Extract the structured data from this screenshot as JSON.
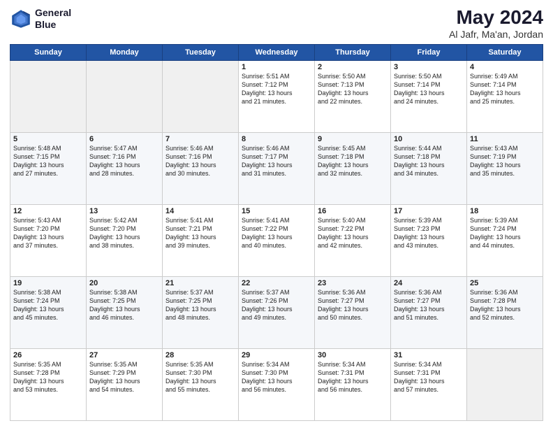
{
  "header": {
    "logo_line1": "General",
    "logo_line2": "Blue",
    "title": "May 2024",
    "subtitle": "Al Jafr, Ma'an, Jordan"
  },
  "days_of_week": [
    "Sunday",
    "Monday",
    "Tuesday",
    "Wednesday",
    "Thursday",
    "Friday",
    "Saturday"
  ],
  "weeks": [
    [
      {
        "day": "",
        "text": ""
      },
      {
        "day": "",
        "text": ""
      },
      {
        "day": "",
        "text": ""
      },
      {
        "day": "1",
        "text": "Sunrise: 5:51 AM\nSunset: 7:12 PM\nDaylight: 13 hours\nand 21 minutes."
      },
      {
        "day": "2",
        "text": "Sunrise: 5:50 AM\nSunset: 7:13 PM\nDaylight: 13 hours\nand 22 minutes."
      },
      {
        "day": "3",
        "text": "Sunrise: 5:50 AM\nSunset: 7:14 PM\nDaylight: 13 hours\nand 24 minutes."
      },
      {
        "day": "4",
        "text": "Sunrise: 5:49 AM\nSunset: 7:14 PM\nDaylight: 13 hours\nand 25 minutes."
      }
    ],
    [
      {
        "day": "5",
        "text": "Sunrise: 5:48 AM\nSunset: 7:15 PM\nDaylight: 13 hours\nand 27 minutes."
      },
      {
        "day": "6",
        "text": "Sunrise: 5:47 AM\nSunset: 7:16 PM\nDaylight: 13 hours\nand 28 minutes."
      },
      {
        "day": "7",
        "text": "Sunrise: 5:46 AM\nSunset: 7:16 PM\nDaylight: 13 hours\nand 30 minutes."
      },
      {
        "day": "8",
        "text": "Sunrise: 5:46 AM\nSunset: 7:17 PM\nDaylight: 13 hours\nand 31 minutes."
      },
      {
        "day": "9",
        "text": "Sunrise: 5:45 AM\nSunset: 7:18 PM\nDaylight: 13 hours\nand 32 minutes."
      },
      {
        "day": "10",
        "text": "Sunrise: 5:44 AM\nSunset: 7:18 PM\nDaylight: 13 hours\nand 34 minutes."
      },
      {
        "day": "11",
        "text": "Sunrise: 5:43 AM\nSunset: 7:19 PM\nDaylight: 13 hours\nand 35 minutes."
      }
    ],
    [
      {
        "day": "12",
        "text": "Sunrise: 5:43 AM\nSunset: 7:20 PM\nDaylight: 13 hours\nand 37 minutes."
      },
      {
        "day": "13",
        "text": "Sunrise: 5:42 AM\nSunset: 7:20 PM\nDaylight: 13 hours\nand 38 minutes."
      },
      {
        "day": "14",
        "text": "Sunrise: 5:41 AM\nSunset: 7:21 PM\nDaylight: 13 hours\nand 39 minutes."
      },
      {
        "day": "15",
        "text": "Sunrise: 5:41 AM\nSunset: 7:22 PM\nDaylight: 13 hours\nand 40 minutes."
      },
      {
        "day": "16",
        "text": "Sunrise: 5:40 AM\nSunset: 7:22 PM\nDaylight: 13 hours\nand 42 minutes."
      },
      {
        "day": "17",
        "text": "Sunrise: 5:39 AM\nSunset: 7:23 PM\nDaylight: 13 hours\nand 43 minutes."
      },
      {
        "day": "18",
        "text": "Sunrise: 5:39 AM\nSunset: 7:24 PM\nDaylight: 13 hours\nand 44 minutes."
      }
    ],
    [
      {
        "day": "19",
        "text": "Sunrise: 5:38 AM\nSunset: 7:24 PM\nDaylight: 13 hours\nand 45 minutes."
      },
      {
        "day": "20",
        "text": "Sunrise: 5:38 AM\nSunset: 7:25 PM\nDaylight: 13 hours\nand 46 minutes."
      },
      {
        "day": "21",
        "text": "Sunrise: 5:37 AM\nSunset: 7:25 PM\nDaylight: 13 hours\nand 48 minutes."
      },
      {
        "day": "22",
        "text": "Sunrise: 5:37 AM\nSunset: 7:26 PM\nDaylight: 13 hours\nand 49 minutes."
      },
      {
        "day": "23",
        "text": "Sunrise: 5:36 AM\nSunset: 7:27 PM\nDaylight: 13 hours\nand 50 minutes."
      },
      {
        "day": "24",
        "text": "Sunrise: 5:36 AM\nSunset: 7:27 PM\nDaylight: 13 hours\nand 51 minutes."
      },
      {
        "day": "25",
        "text": "Sunrise: 5:36 AM\nSunset: 7:28 PM\nDaylight: 13 hours\nand 52 minutes."
      }
    ],
    [
      {
        "day": "26",
        "text": "Sunrise: 5:35 AM\nSunset: 7:28 PM\nDaylight: 13 hours\nand 53 minutes."
      },
      {
        "day": "27",
        "text": "Sunrise: 5:35 AM\nSunset: 7:29 PM\nDaylight: 13 hours\nand 54 minutes."
      },
      {
        "day": "28",
        "text": "Sunrise: 5:35 AM\nSunset: 7:30 PM\nDaylight: 13 hours\nand 55 minutes."
      },
      {
        "day": "29",
        "text": "Sunrise: 5:34 AM\nSunset: 7:30 PM\nDaylight: 13 hours\nand 56 minutes."
      },
      {
        "day": "30",
        "text": "Sunrise: 5:34 AM\nSunset: 7:31 PM\nDaylight: 13 hours\nand 56 minutes."
      },
      {
        "day": "31",
        "text": "Sunrise: 5:34 AM\nSunset: 7:31 PM\nDaylight: 13 hours\nand 57 minutes."
      },
      {
        "day": "",
        "text": ""
      }
    ]
  ]
}
